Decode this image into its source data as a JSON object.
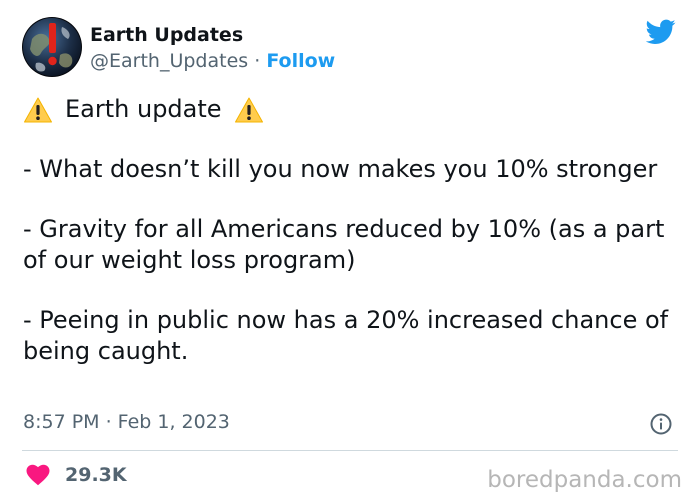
{
  "author": {
    "display_name": "Earth Updates",
    "handle": "@Earth_Updates",
    "separator": "·",
    "follow_label": "Follow",
    "avatar": "earth-with-warning-avatar"
  },
  "platform_icon": "twitter-bird-icon",
  "tweet": {
    "headline": "Earth update",
    "headline_icon": "warning-icon",
    "paragraphs": [
      "- What doesn’t kill you now makes you 10% stronger",
      "- Gravity for all Americans reduced by 10% (as a part of our weight loss program)",
      "- Peeing in public now has a 20% increased chance of being caught."
    ]
  },
  "meta": {
    "timestamp": "8:57 PM · Feb 1, 2023",
    "info_icon": "info-icon"
  },
  "engagement": {
    "likes": "29.3K",
    "like_icon": "heart-icon"
  },
  "watermark": "boredpanda.com",
  "colors": {
    "accent": "#1d9bf0",
    "heart": "#f91880",
    "muted": "#536471",
    "warning": "#ffcc4d"
  }
}
